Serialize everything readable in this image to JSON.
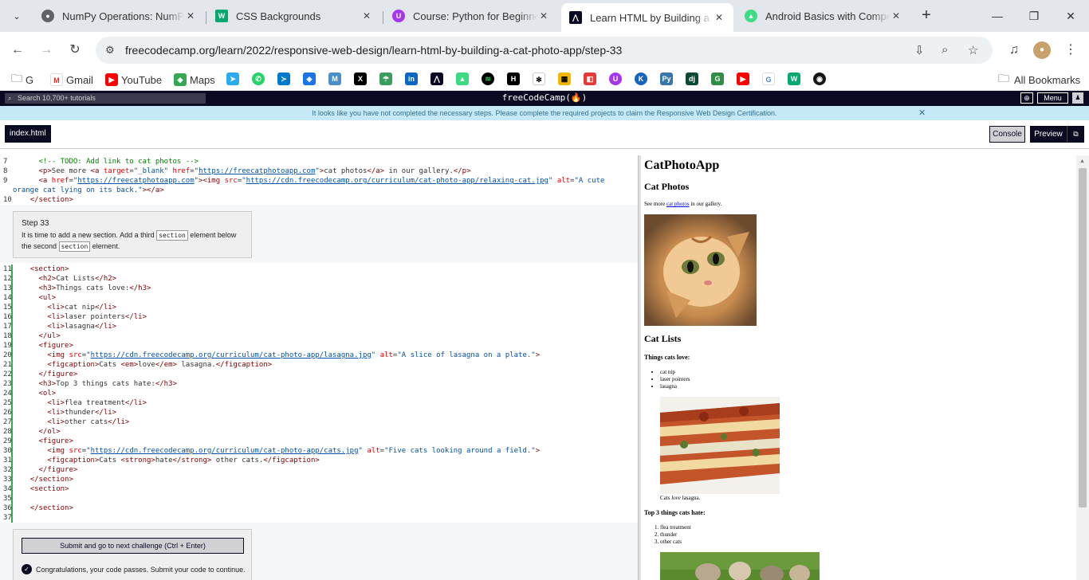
{
  "browser": {
    "tabs": [
      {
        "title": "NumPy Operations: NumPy",
        "favicon_color": "#5f6368"
      },
      {
        "title": "CSS Backgrounds",
        "favicon_color": "#04aa6d"
      },
      {
        "title": "Course: Python for Beginner",
        "favicon_color": "#a435f0"
      },
      {
        "title": "Learn HTML by Building a Ca",
        "favicon_color": "#0a0a23"
      },
      {
        "title": "Android Basics with Compose",
        "favicon_color": "#3ddc84"
      }
    ],
    "url": "freecodecamp.org/learn/2022/responsive-web-design/learn-html-by-building-a-cat-photo-app/step-33",
    "bookmarks": [
      {
        "label": "G",
        "icon": "folder-icon"
      },
      {
        "label": "Gmail",
        "icon": "gmail-icon"
      },
      {
        "label": "YouTube",
        "icon": "youtube-icon"
      },
      {
        "label": "Maps",
        "icon": "maps-icon"
      }
    ],
    "all_bookmarks": "All Bookmarks"
  },
  "fcc": {
    "search_placeholder": "Search 10,700+ tutorials",
    "logo": "freeCodeCamp(🔥)",
    "menu_label": "Menu",
    "flash": "It looks like you have not completed the necessary steps. Please complete the required projects to claim the Responsive Web Design Certification.",
    "file_tab": "index.html",
    "console_label": "Console",
    "preview_label": "Preview"
  },
  "step": {
    "title": "Step 33",
    "text_1": "It is time to add a new section. Add a third",
    "tag": "section",
    "text_2": "element below the second",
    "text_3": "element."
  },
  "submit": {
    "button": "Submit and go to next challenge (Ctrl + Enter)",
    "message": "Congratulations, your code passes. Submit your code to continue."
  },
  "preview": {
    "h1": "CatPhotoApp",
    "h2_photos": "Cat Photos",
    "p_before": "See more",
    "p_link": "cat photos",
    "p_after": "in our gallery.",
    "h2_lists": "Cat Lists",
    "h3_love": "Things cats love:",
    "love_items": [
      "cat nip",
      "laser pointers",
      "lasagna"
    ],
    "caption_love_a": "Cats",
    "caption_love_em": "love",
    "caption_love_b": "lasagna.",
    "h3_hate": "Top 3 things cats hate:",
    "hate_items": [
      "flea treatment",
      "thunder",
      "other cats"
    ]
  }
}
